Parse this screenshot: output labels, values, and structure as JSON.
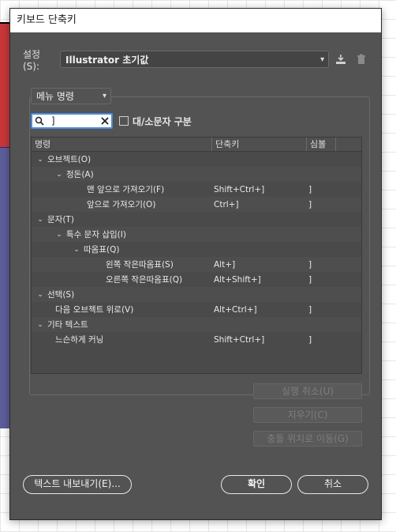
{
  "window": {
    "title": "키보드 단축키"
  },
  "settings": {
    "label": "설정(S):",
    "preset_value": "Illustrator 초기값",
    "icons": [
      "save-preset-icon",
      "delete-preset-icon"
    ]
  },
  "category": {
    "selected": "메뉴 명령"
  },
  "search": {
    "value": "]",
    "clear_icon": "clear-icon"
  },
  "case_sensitive": {
    "label": "대/소문자 구분",
    "checked": false
  },
  "table": {
    "columns": [
      "명령",
      "단축키",
      "심볼"
    ],
    "rows": [
      {
        "indent": 0,
        "disclosure": "⌄",
        "name": "오브젝트(O)",
        "shortcut": "",
        "symbol": ""
      },
      {
        "indent": 1,
        "disclosure": "⌄",
        "name": "정돈(A)",
        "shortcut": "",
        "symbol": ""
      },
      {
        "indent": 2,
        "disclosure": "",
        "name": "맨 앞으로 가져오기(F)",
        "shortcut": "Shift+Ctrl+]",
        "symbol": "]"
      },
      {
        "indent": 2,
        "disclosure": "",
        "name": "앞으로 가져오기(O)",
        "shortcut": "Ctrl+]",
        "symbol": "]"
      },
      {
        "indent": 0,
        "disclosure": "⌄",
        "name": "문자(T)",
        "shortcut": "",
        "symbol": ""
      },
      {
        "indent": 1,
        "disclosure": "⌄",
        "name": "특수 문자 삽입(I)",
        "shortcut": "",
        "symbol": ""
      },
      {
        "indent": 2,
        "disclosure": "⌄",
        "name": "따옴표(Q)",
        "shortcut": "",
        "symbol": ""
      },
      {
        "indent": 3,
        "disclosure": "",
        "name": "왼쪽 작은따옴표(S)",
        "shortcut": "Alt+]",
        "symbol": "]"
      },
      {
        "indent": 3,
        "disclosure": "",
        "name": "오른쪽 작은따옴표(Q)",
        "shortcut": "Alt+Shift+]",
        "symbol": "]"
      },
      {
        "indent": 0,
        "disclosure": "⌄",
        "name": "선택(S)",
        "shortcut": "",
        "symbol": ""
      },
      {
        "indent": 1,
        "disclosure": "",
        "name": "다음 오브젝트 위로(V)",
        "shortcut": "Alt+Ctrl+]",
        "symbol": "]"
      },
      {
        "indent": 0,
        "disclosure": "⌄",
        "name": "기타 텍스트",
        "shortcut": "",
        "symbol": ""
      },
      {
        "indent": 1,
        "disclosure": "",
        "name": "느슨하게 커닝",
        "shortcut": "Shift+Ctrl+]",
        "symbol": "]"
      }
    ]
  },
  "side_buttons": {
    "undo": "실행 취소(U)",
    "clear": "지우기(C)",
    "goto_conflict": "충돌 위치로 이동(G)"
  },
  "buttons": {
    "export": "텍스트 내보내기(E)...",
    "ok": "확인",
    "cancel": "취소"
  }
}
